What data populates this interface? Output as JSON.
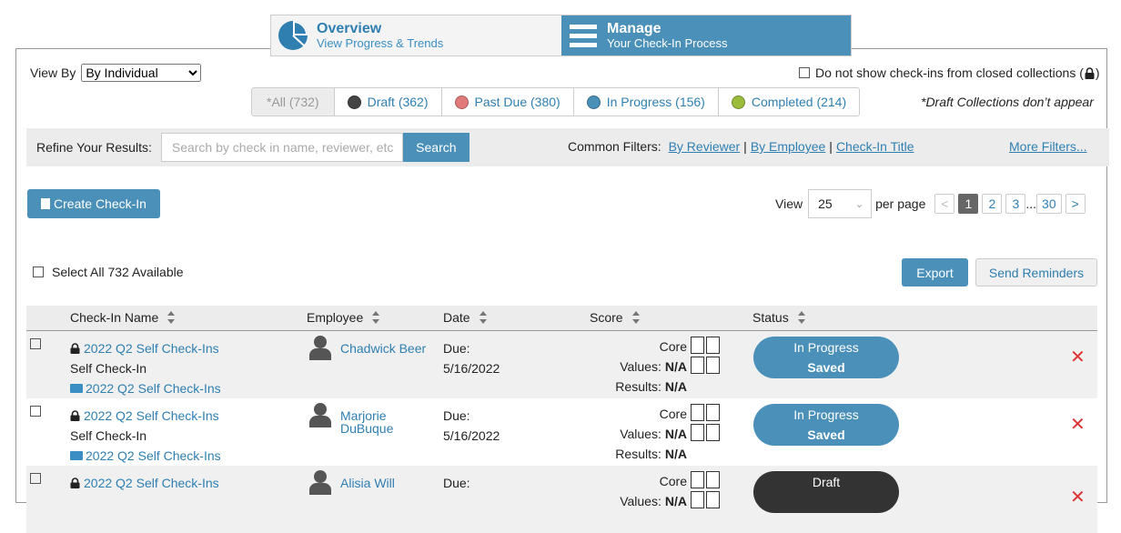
{
  "nav": {
    "overview_title": "Overview",
    "overview_sub": "View Progress & Trends",
    "manage_title": "Manage",
    "manage_sub": "Your Check-In Process"
  },
  "view_by": {
    "label": "View By",
    "selected": "By Individual"
  },
  "closed_filter": {
    "label": "Do not show check-ins from closed collections (",
    "suffix": ")"
  },
  "status_filters": [
    {
      "label": "*All (732)",
      "color": ""
    },
    {
      "label": "Draft (362)",
      "color": "#444444"
    },
    {
      "label": "Past Due (380)",
      "color": "#e07a7a"
    },
    {
      "label": "In Progress (156)",
      "color": "#4a90b8"
    },
    {
      "label": "Completed (214)",
      "color": "#9bbb3c"
    }
  ],
  "draft_note": "*Draft Collections don’t appear",
  "refine": {
    "label": "Refine Your Results:",
    "placeholder": "Search by check in name, reviewer, etc",
    "search_button": "Search",
    "common_label": "Common Filters:",
    "by_reviewer": "By Reviewer",
    "by_employee": "By Employee",
    "checkin_title": "Check-In Title",
    "sep": "|",
    "more": "More Filters..."
  },
  "create_button": "Create Check-In",
  "pagination": {
    "view_label": "View",
    "per_page_value": "25",
    "per_page_label": "per page",
    "prev": "<",
    "pages": [
      "1",
      "2",
      "3"
    ],
    "ellipsis": "...",
    "last": "30",
    "next": ">"
  },
  "select_all": "Select All 732 Available",
  "export_button": "Export",
  "reminders_button": "Send Reminders",
  "columns": {
    "name": "Check-In Name",
    "employee": "Employee",
    "date": "Date",
    "score": "Score",
    "status": "Status"
  },
  "rows": [
    {
      "title": "2022 Q2 Self Check-Ins",
      "type": "Self Check-In",
      "collection": "2022 Q2 Self Check-Ins",
      "employee": "Chadwick Beer",
      "due_label": "Due:",
      "due_date": "5/16/2022",
      "core_label": "Core Values:",
      "core_value": "N/A",
      "results_label": "Results:",
      "results_value": "N/A",
      "status1": "In Progress",
      "status2": "Saved",
      "status_color": "#4a90b8",
      "delete": "✕"
    },
    {
      "title": "2022 Q2 Self Check-Ins",
      "type": "Self Check-In",
      "collection": "2022 Q2 Self Check-Ins",
      "employee": "Marjorie DuBuque",
      "due_label": "Due:",
      "due_date": "5/16/2022",
      "core_label": "Core Values:",
      "core_value": "N/A",
      "results_label": "Results:",
      "results_value": "N/A",
      "status1": "In Progress",
      "status2": "Saved",
      "status_color": "#4a90b8",
      "delete": "✕"
    },
    {
      "title": "2022 Q2 Self Check-Ins",
      "type": "",
      "collection": "",
      "employee": "Alisia Will",
      "due_label": "Due:",
      "due_date": "",
      "core_label": "Core Values:",
      "core_value": "N/A",
      "results_label": "",
      "results_value": "",
      "status1": "Draft",
      "status2": "",
      "status_color": "#333333",
      "delete": "✕"
    }
  ]
}
